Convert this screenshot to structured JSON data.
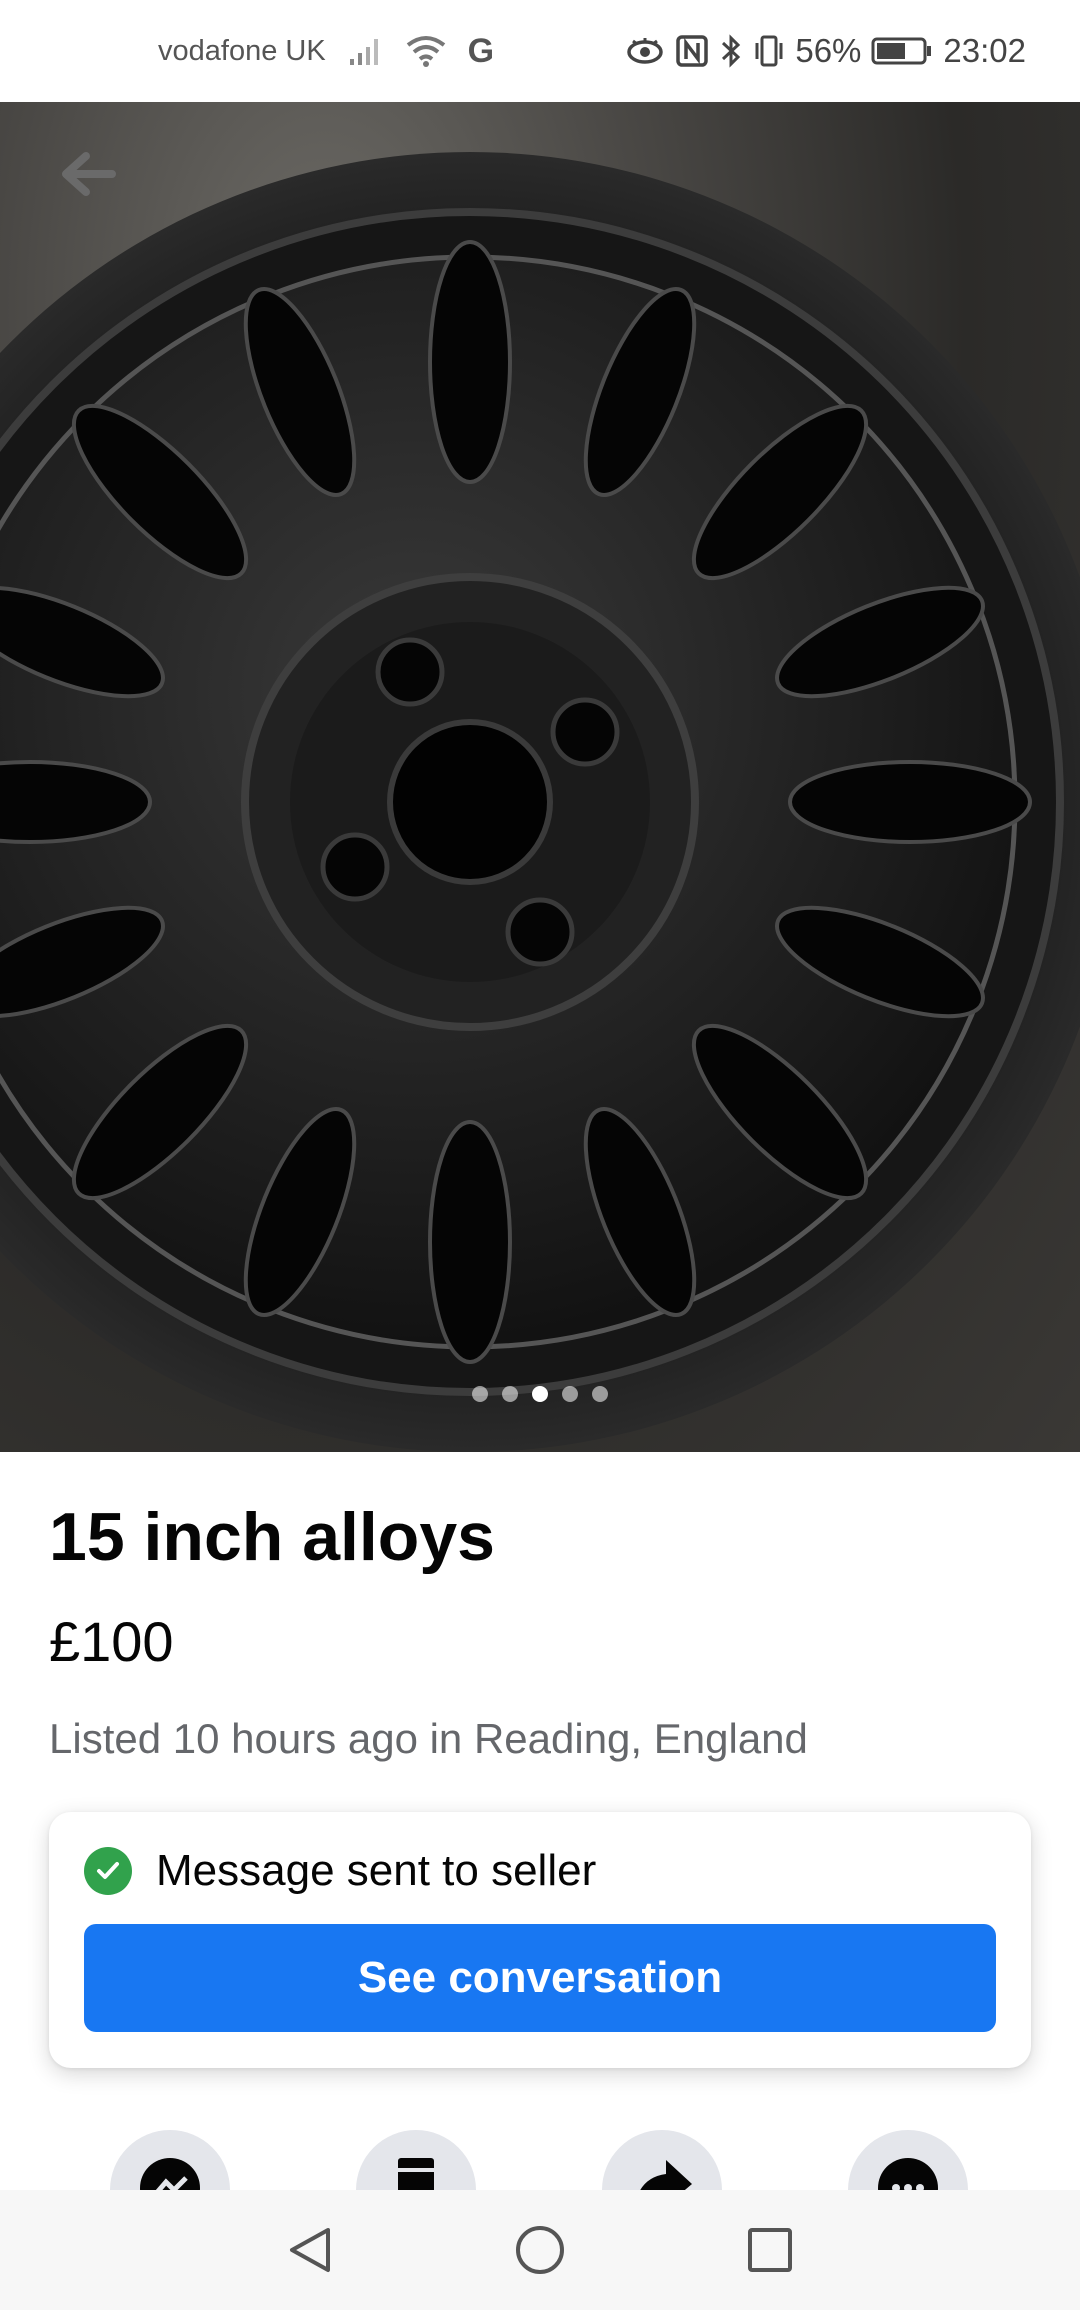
{
  "status_bar": {
    "carrier": "vodafone UK",
    "battery": "56%",
    "time": "23:02",
    "icons": [
      "signal-icon",
      "wifi-icon",
      "g-icon",
      "eye-icon",
      "nfc-icon",
      "bluetooth-icon",
      "vibrate-icon",
      "battery-icon"
    ]
  },
  "hero": {
    "image_alt": "wheel-photo",
    "dot_count": 5,
    "active_dot_index": 2
  },
  "listing": {
    "title": "15 inch alloys",
    "price": "£100",
    "listed": "Listed 10 hours ago in Reading, England"
  },
  "message_card": {
    "status": "Message sent to seller",
    "button_label": "See conversation"
  },
  "actions": [
    {
      "icon": "messenger-icon"
    },
    {
      "icon": "save-icon"
    },
    {
      "icon": "share-icon"
    },
    {
      "icon": "more-icon"
    }
  ],
  "nav": {
    "icons": [
      "back-icon",
      "home-icon",
      "recents-icon"
    ]
  },
  "colors": {
    "accent": "#1877f2",
    "success": "#31a24c",
    "secondary_text": "#65676b"
  }
}
